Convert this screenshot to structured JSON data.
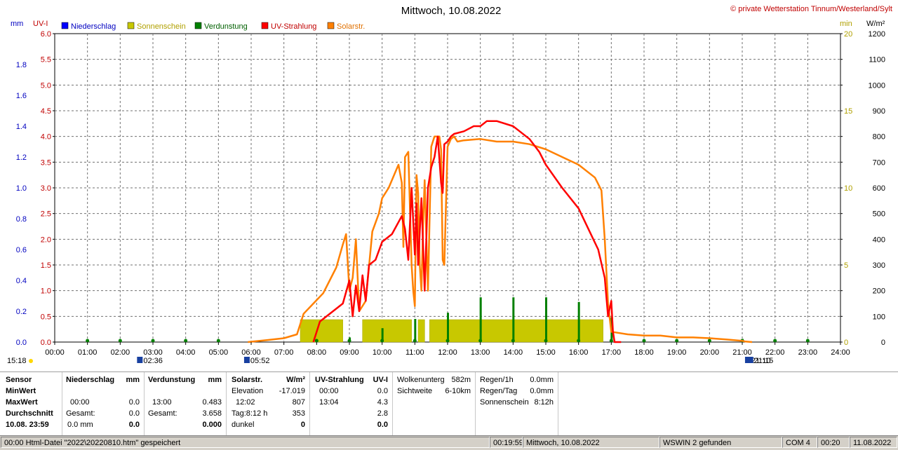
{
  "chart_data": {
    "type": "line",
    "title": "Mittwoch, 10.08.2022",
    "copyright": "© private Wetterstation Tinnum/Westerland/Sylt",
    "x_ticks": [
      "00:00",
      "01:00",
      "02:00",
      "03:00",
      "04:00",
      "05:00",
      "06:00",
      "07:00",
      "08:00",
      "09:00",
      "10:00",
      "11:00",
      "12:00",
      "13:00",
      "14:00",
      "15:00",
      "16:00",
      "17:00",
      "18:00",
      "19:00",
      "20:00",
      "21:00",
      "22:00",
      "23:00",
      "24:00"
    ],
    "xlim": [
      0,
      24
    ],
    "axes": {
      "mm": {
        "label": "mm",
        "range": [
          0,
          2.0
        ],
        "ticks": [
          "0.0",
          "0.2",
          "0.4",
          "0.6",
          "0.8",
          "1.0",
          "1.2",
          "1.4",
          "1.6",
          "1.8"
        ],
        "tick_values": [
          0,
          0.2,
          0.4,
          0.6,
          0.8,
          1.0,
          1.2,
          1.4,
          1.6,
          1.8
        ],
        "color": "#0000c0"
      },
      "uv": {
        "label": "UV-I",
        "range": [
          0,
          6.0
        ],
        "ticks": [
          "0.0",
          "0.5",
          "1.0",
          "1.5",
          "2.0",
          "2.5",
          "3.0",
          "3.5",
          "4.0",
          "4.5",
          "5.0",
          "5.5",
          "6.0"
        ],
        "tick_values": [
          0,
          0.5,
          1,
          1.5,
          2,
          2.5,
          3,
          3.5,
          4,
          4.5,
          5,
          5.5,
          6
        ],
        "color": "#c00000"
      },
      "min": {
        "label": "min",
        "range": [
          0,
          20
        ],
        "ticks": [
          "0",
          "5",
          "10",
          "15",
          "20"
        ],
        "tick_values": [
          0,
          5,
          10,
          15,
          20
        ],
        "color": "#b0a000"
      },
      "wm2": {
        "label": "W/m²",
        "range": [
          0,
          1200
        ],
        "ticks": [
          "0",
          "100",
          "200",
          "300",
          "400",
          "500",
          "600",
          "700",
          "800",
          "900",
          "1000",
          "1100",
          "1200"
        ],
        "tick_values": [
          0,
          100,
          200,
          300,
          400,
          500,
          600,
          700,
          800,
          900,
          1000,
          1100,
          1200
        ],
        "color": "#000000"
      }
    },
    "legend": [
      {
        "name": "Niederschlag",
        "color": "#0000ff",
        "text_color": "#0000c0"
      },
      {
        "name": "Sonnenschein",
        "color": "#c8c800",
        "text_color": "#b0a000"
      },
      {
        "name": "Verdunstung",
        "color": "#008000",
        "text_color": "#006000"
      },
      {
        "name": "UV-Strahlung",
        "color": "#ff0000",
        "text_color": "#c00000"
      },
      {
        "name": "Solarstr.",
        "color": "#ff8000",
        "text_color": "#e07000"
      }
    ],
    "grid": true,
    "sun_events": [
      {
        "label": "15:18",
        "x": -1.0
      },
      {
        "label": "02:36",
        "x": 2.6
      },
      {
        "label": "05:52",
        "x": 5.87
      },
      {
        "label": "21:10",
        "x": 21.17
      },
      {
        "label": "21:15",
        "x": 21.25
      }
    ],
    "sunshine_blocks": [
      [
        7.5,
        8.8
      ],
      [
        9.4,
        10.9
      ],
      [
        11.1,
        11.3
      ],
      [
        11.45,
        16.75
      ]
    ],
    "sunshine_level_min": 1.0,
    "evaporation_spikes": [
      {
        "x": 1.0,
        "mm": 0.01
      },
      {
        "x": 2.0,
        "mm": 0.01
      },
      {
        "x": 3.0,
        "mm": 0.01
      },
      {
        "x": 4.0,
        "mm": 0.01
      },
      {
        "x": 5.0,
        "mm": 0.01
      },
      {
        "x": 8.0,
        "mm": 0.01
      },
      {
        "x": 9.0,
        "mm": 0.03
      },
      {
        "x": 10.0,
        "mm": 0.09
      },
      {
        "x": 11.0,
        "mm": 0.15
      },
      {
        "x": 12.0,
        "mm": 0.19
      },
      {
        "x": 13.0,
        "mm": 0.29
      },
      {
        "x": 14.0,
        "mm": 0.29
      },
      {
        "x": 15.0,
        "mm": 0.29
      },
      {
        "x": 16.0,
        "mm": 0.26
      },
      {
        "x": 17.0,
        "mm": 0.16
      },
      {
        "x": 18.0,
        "mm": 0.01
      },
      {
        "x": 19.0,
        "mm": 0.01
      },
      {
        "x": 20.0,
        "mm": 0.01
      },
      {
        "x": 21.0,
        "mm": 0.02
      },
      {
        "x": 22.0,
        "mm": 0.01
      },
      {
        "x": 23.0,
        "mm": 0.01
      }
    ],
    "series": [
      {
        "name": "Solarstr.",
        "axis": "wm2",
        "color": "#ff8000",
        "x": [
          5.9,
          6.5,
          7.0,
          7.4,
          7.6,
          7.9,
          8.2,
          8.4,
          8.6,
          8.8,
          8.9,
          9.0,
          9.1,
          9.2,
          9.3,
          9.5,
          9.7,
          9.9,
          10.0,
          10.2,
          10.4,
          10.5,
          10.6,
          10.65,
          10.7,
          10.8,
          10.9,
          10.95,
          11.0,
          11.05,
          11.1,
          11.15,
          11.2,
          11.25,
          11.3,
          11.4,
          11.5,
          11.6,
          11.75,
          11.8,
          11.85,
          11.9,
          12.0,
          12.1,
          12.2,
          12.3,
          12.5,
          13.0,
          13.5,
          14.0,
          14.5,
          15.0,
          15.5,
          16.0,
          16.5,
          16.7,
          16.8,
          16.9,
          17.0,
          17.5,
          18.0,
          18.5,
          19.0,
          19.5,
          20.0,
          20.5,
          21.0,
          21.1,
          21.3
        ],
        "y": [
          0,
          8,
          15,
          30,
          110,
          150,
          190,
          240,
          290,
          380,
          420,
          200,
          250,
          400,
          120,
          160,
          430,
          500,
          560,
          600,
          660,
          690,
          620,
          370,
          720,
          740,
          300,
          200,
          140,
          650,
          580,
          300,
          200,
          450,
          630,
          200,
          760,
          800,
          800,
          750,
          320,
          300,
          760,
          790,
          800,
          780,
          785,
          790,
          780,
          780,
          770,
          750,
          720,
          690,
          640,
          590,
          400,
          150,
          40,
          30,
          25,
          25,
          18,
          18,
          15,
          10,
          5,
          2,
          0
        ]
      },
      {
        "name": "UV-Strahlung",
        "axis": "uv",
        "color": "#ff0000",
        "x": [
          7.9,
          8.1,
          8.2,
          8.5,
          8.8,
          9.0,
          9.1,
          9.2,
          9.3,
          9.4,
          9.5,
          9.6,
          9.8,
          10.0,
          10.3,
          10.6,
          10.7,
          10.8,
          10.9,
          11.0,
          11.05,
          11.1,
          11.2,
          11.3,
          11.4,
          11.5,
          11.6,
          11.7,
          11.8,
          11.85,
          11.9,
          12.0,
          12.1,
          12.2,
          12.5,
          12.8,
          13.0,
          13.2,
          13.5,
          14.0,
          14.2,
          14.5,
          14.8,
          15.0,
          15.5,
          16.0,
          16.3,
          16.6,
          16.8,
          16.9,
          17.0,
          17.05,
          17.1,
          17.2,
          17.3
        ],
        "y": [
          0,
          0.4,
          0.45,
          0.6,
          0.75,
          1.2,
          0.5,
          1.1,
          0.6,
          1.3,
          0.8,
          1.5,
          1.6,
          1.95,
          2.1,
          2.45,
          2.2,
          1.6,
          3.0,
          1.7,
          2.7,
          1.5,
          2.8,
          1.0,
          3.0,
          3.4,
          3.6,
          4.0,
          3.1,
          2.9,
          3.85,
          3.9,
          4.0,
          4.05,
          4.1,
          4.2,
          4.2,
          4.3,
          4.3,
          4.2,
          4.1,
          3.95,
          3.7,
          3.45,
          3.0,
          2.6,
          2.2,
          1.8,
          1.25,
          0.5,
          0.8,
          0.2,
          0.0,
          0.0,
          0.0
        ]
      }
    ]
  },
  "stats": {
    "sensor": {
      "head": "Sensor",
      "rows": [
        "MinWert",
        "MaxWert",
        "Durchschnitt",
        "10.08. 23:59"
      ]
    },
    "niederschlag": {
      "head": "Niederschlag",
      "unit": "mm",
      "r1": {
        "a": "",
        "b": ""
      },
      "r2": {
        "a": "00:00",
        "b": "0.0"
      },
      "r3": {
        "a": "Gesamt:",
        "b": "0.0"
      },
      "r4": {
        "a": "0.0 mm",
        "b": "0.0"
      }
    },
    "verdunstung": {
      "head": "Verdunstung",
      "unit": "mm",
      "r1": {
        "a": "",
        "b": ""
      },
      "r2": {
        "a": "13:00",
        "b": "0.483"
      },
      "r3": {
        "a": "Gesamt:",
        "b": "3.658"
      },
      "r4": {
        "a": "",
        "b": "0.000"
      }
    },
    "solar": {
      "head": "Solarstr.",
      "unit": "W/m²",
      "r1": {
        "a": "Elevation",
        "b": "-17.019"
      },
      "r2": {
        "a": "12:02",
        "b": "807"
      },
      "r3": {
        "a": "Tag:8:12 h",
        "b": "353"
      },
      "r4": {
        "a": "dunkel",
        "b": "0"
      }
    },
    "uv": {
      "head": "UV-Strahlung",
      "unit": "UV-I",
      "r1": {
        "a": "00:00",
        "b": "0.0"
      },
      "r2": {
        "a": "13:04",
        "b": "4.3"
      },
      "r3": {
        "a": "",
        "b": "2.8"
      },
      "r4": {
        "a": "",
        "b": "0.0"
      }
    },
    "wolken": {
      "l1": "Wolkenunterg",
      "v1": "582m",
      "l2": "Sichtweite",
      "v2": "6-10km"
    },
    "regen": {
      "l1": "Regen/1h",
      "v1": "0.0mm",
      "l2": "Regen/Tag",
      "v2": "0.0mm",
      "l3": "Sonnenschein",
      "v3": "8:12h"
    }
  },
  "status": {
    "s1": "00:00  Html-Datei  \"2022\\20220810.htm\"  gespeichert",
    "s2": "00:19:59",
    "s3": "Mittwoch, 10.08.2022",
    "s4": "WSWIN 2 gefunden",
    "s5": "COM 4",
    "s6": "00:20",
    "s7": "11.08.2022"
  }
}
